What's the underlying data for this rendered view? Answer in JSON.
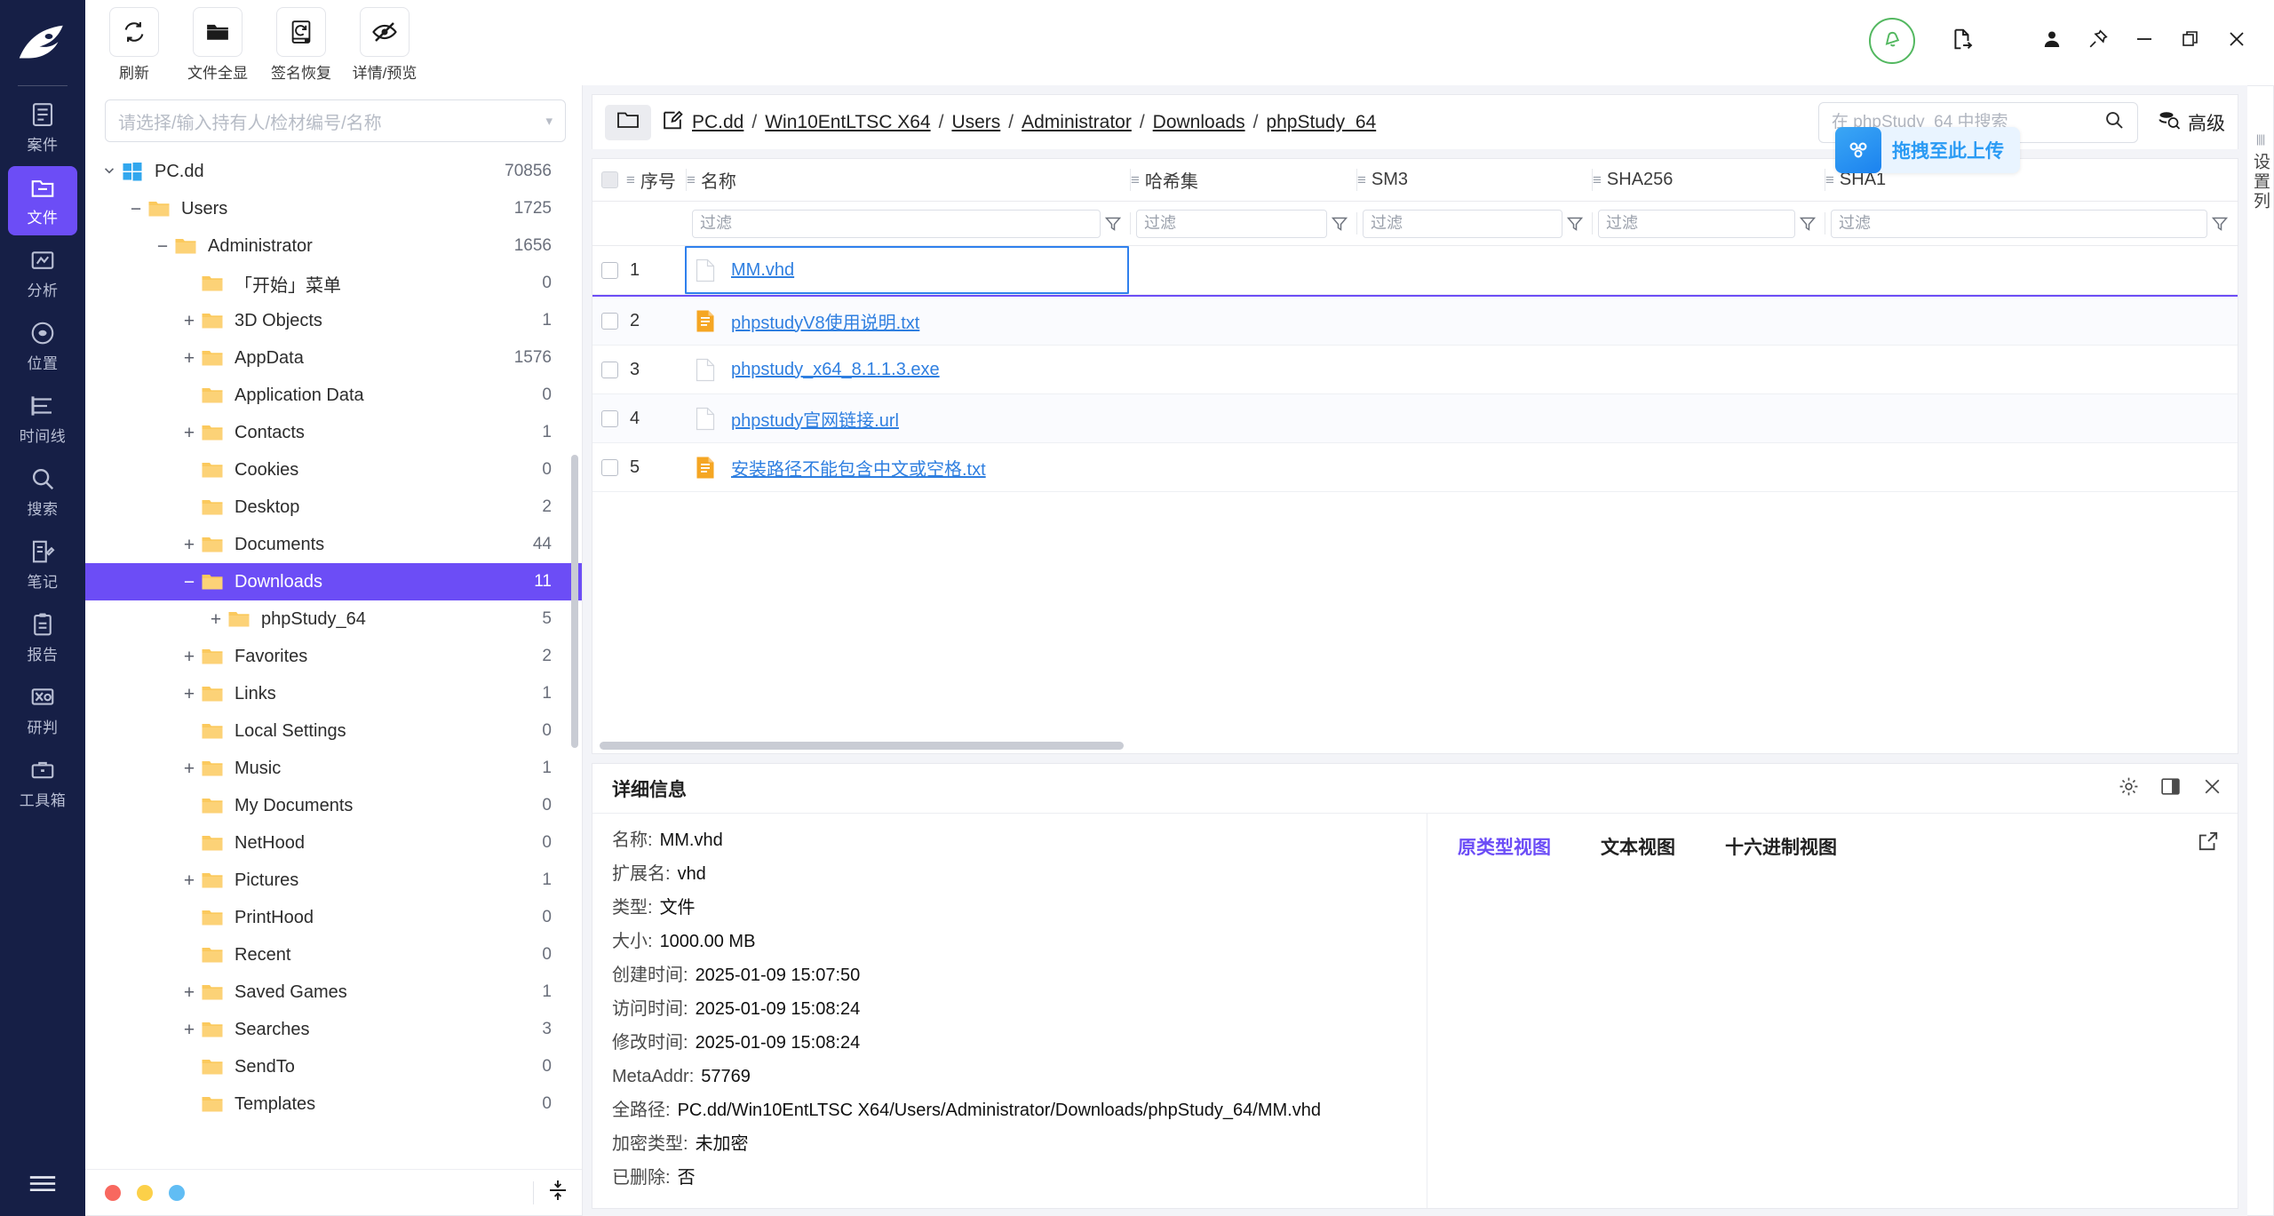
{
  "rail": {
    "items": [
      {
        "label": "案件",
        "icon": "case-icon",
        "active": false
      },
      {
        "label": "文件",
        "icon": "folder-icon",
        "active": true
      },
      {
        "label": "分析",
        "icon": "analysis-icon",
        "active": false
      },
      {
        "label": "位置",
        "icon": "location-icon",
        "active": false
      },
      {
        "label": "时间线",
        "icon": "timeline-icon",
        "active": false
      },
      {
        "label": "搜索",
        "icon": "search-icon",
        "active": false
      },
      {
        "label": "笔记",
        "icon": "note-icon",
        "active": false
      },
      {
        "label": "报告",
        "icon": "report-icon",
        "active": false
      },
      {
        "label": "研判",
        "icon": "judgement-icon",
        "active": false
      },
      {
        "label": "工具箱",
        "icon": "toolbox-icon",
        "active": false
      }
    ]
  },
  "toolbar": {
    "buttons": [
      {
        "label": "刷新",
        "icon": "refresh-icon"
      },
      {
        "label": "文件全显",
        "icon": "folder-all-icon"
      },
      {
        "label": "签名恢复",
        "icon": "signature-recover-icon"
      },
      {
        "label": "详情/预览",
        "icon": "eye-off-icon"
      }
    ]
  },
  "tree": {
    "search_placeholder": "请选择/输入持有人/检材编号/名称",
    "nodes": [
      {
        "label": "PC.dd",
        "count": "70856",
        "depth": 0,
        "expander": "collapse-caret",
        "icon": "windows-icon",
        "selected": false
      },
      {
        "label": "Users",
        "count": "1725",
        "depth": 1,
        "expander": "minus",
        "icon": "folder-icon",
        "selected": false
      },
      {
        "label": "Administrator",
        "count": "1656",
        "depth": 2,
        "expander": "minus",
        "icon": "folder-icon",
        "selected": false
      },
      {
        "label": "「开始」菜单",
        "count": "0",
        "depth": 3,
        "expander": "none",
        "icon": "folder-icon",
        "selected": false
      },
      {
        "label": "3D Objects",
        "count": "1",
        "depth": 3,
        "expander": "plus",
        "icon": "folder-icon",
        "selected": false
      },
      {
        "label": "AppData",
        "count": "1576",
        "depth": 3,
        "expander": "plus",
        "icon": "folder-icon",
        "selected": false
      },
      {
        "label": "Application Data",
        "count": "0",
        "depth": 3,
        "expander": "none",
        "icon": "folder-icon",
        "selected": false
      },
      {
        "label": "Contacts",
        "count": "1",
        "depth": 3,
        "expander": "plus",
        "icon": "folder-icon",
        "selected": false
      },
      {
        "label": "Cookies",
        "count": "0",
        "depth": 3,
        "expander": "none",
        "icon": "folder-icon",
        "selected": false
      },
      {
        "label": "Desktop",
        "count": "2",
        "depth": 3,
        "expander": "none",
        "icon": "folder-icon",
        "selected": false
      },
      {
        "label": "Documents",
        "count": "44",
        "depth": 3,
        "expander": "plus",
        "icon": "folder-icon",
        "selected": false
      },
      {
        "label": "Downloads",
        "count": "11",
        "depth": 3,
        "expander": "minus",
        "icon": "folder-icon",
        "selected": true
      },
      {
        "label": "phpStudy_64",
        "count": "5",
        "depth": 4,
        "expander": "plus",
        "icon": "folder-icon",
        "selected": false
      },
      {
        "label": "Favorites",
        "count": "2",
        "depth": 3,
        "expander": "plus",
        "icon": "folder-icon",
        "selected": false
      },
      {
        "label": "Links",
        "count": "1",
        "depth": 3,
        "expander": "plus",
        "icon": "folder-icon",
        "selected": false
      },
      {
        "label": "Local Settings",
        "count": "0",
        "depth": 3,
        "expander": "none",
        "icon": "folder-icon",
        "selected": false
      },
      {
        "label": "Music",
        "count": "1",
        "depth": 3,
        "expander": "plus",
        "icon": "folder-icon",
        "selected": false
      },
      {
        "label": "My Documents",
        "count": "0",
        "depth": 3,
        "expander": "none",
        "icon": "folder-icon",
        "selected": false
      },
      {
        "label": "NetHood",
        "count": "0",
        "depth": 3,
        "expander": "none",
        "icon": "folder-icon",
        "selected": false
      },
      {
        "label": "Pictures",
        "count": "1",
        "depth": 3,
        "expander": "plus",
        "icon": "folder-icon",
        "selected": false
      },
      {
        "label": "PrintHood",
        "count": "0",
        "depth": 3,
        "expander": "none",
        "icon": "folder-icon",
        "selected": false
      },
      {
        "label": "Recent",
        "count": "0",
        "depth": 3,
        "expander": "none",
        "icon": "folder-icon",
        "selected": false
      },
      {
        "label": "Saved Games",
        "count": "1",
        "depth": 3,
        "expander": "plus",
        "icon": "folder-icon",
        "selected": false
      },
      {
        "label": "Searches",
        "count": "3",
        "depth": 3,
        "expander": "plus",
        "icon": "folder-icon",
        "selected": false
      },
      {
        "label": "SendTo",
        "count": "0",
        "depth": 3,
        "expander": "none",
        "icon": "folder-icon",
        "selected": false
      },
      {
        "label": "Templates",
        "count": "0",
        "depth": 3,
        "expander": "none",
        "icon": "folder-icon",
        "selected": false
      }
    ],
    "footer_dots": [
      "#f8685f",
      "#fcd049",
      "#61bdf4"
    ]
  },
  "breadcrumb": {
    "segments": [
      "PC.dd",
      "Win10EntLTSC X64",
      "Users",
      "Administrator",
      "Downloads",
      "phpStudy_64"
    ],
    "separator": "/"
  },
  "search": {
    "placeholder": "在 phpStudy_64 中搜索",
    "value": "",
    "advanced_label": "高级"
  },
  "upload_badge": {
    "label": "拖拽至此上传"
  },
  "column_setting": {
    "label": "设置列"
  },
  "table": {
    "columns": [
      "序号",
      "名称",
      "哈希集",
      "SM3",
      "SHA256",
      "SHA1"
    ],
    "filter_placeholder": "过滤",
    "rows": [
      {
        "index": "1",
        "name": "MM.vhd",
        "icon": "file-blank-icon",
        "hash": "",
        "sm3": "",
        "sha256": "",
        "sha1": "",
        "selected": true
      },
      {
        "index": "2",
        "name": "phpstudyV8使用说明.txt",
        "icon": "file-text-icon",
        "hash": "",
        "sm3": "",
        "sha256": "",
        "sha1": "",
        "selected": false
      },
      {
        "index": "3",
        "name": "phpstudy_x64_8.1.1.3.exe",
        "icon": "file-blank-icon",
        "hash": "",
        "sm3": "",
        "sha256": "",
        "sha1": "",
        "selected": false
      },
      {
        "index": "4",
        "name": "phpstudy官网链接.url",
        "icon": "file-blank-icon",
        "hash": "",
        "sm3": "",
        "sha256": "",
        "sha1": "",
        "selected": false
      },
      {
        "index": "5",
        "name": "安装路径不能包含中文或空格.txt",
        "icon": "file-text-icon",
        "hash": "",
        "sm3": "",
        "sha256": "",
        "sha1": "",
        "selected": false
      }
    ]
  },
  "detail": {
    "title": "详细信息",
    "fields": [
      {
        "key": "名称:",
        "value": "MM.vhd"
      },
      {
        "key": "扩展名:",
        "value": "vhd"
      },
      {
        "key": "类型:",
        "value": "文件"
      },
      {
        "key": "大小:",
        "value": "1000.00 MB"
      },
      {
        "key": "创建时间:",
        "value": "2025-01-09 15:07:50"
      },
      {
        "key": "访问时间:",
        "value": "2025-01-09 15:08:24"
      },
      {
        "key": "修改时间:",
        "value": "2025-01-09 15:08:24"
      },
      {
        "key": "MetaAddr:",
        "value": "57769"
      },
      {
        "key": "全路径:",
        "value": "PC.dd/Win10EntLTSC X64/Users/Administrator/Downloads/phpStudy_64/MM.vhd"
      },
      {
        "key": "加密类型:",
        "value": "未加密"
      },
      {
        "key": "已删除:",
        "value": "否"
      }
    ],
    "view_tabs": [
      {
        "label": "原类型视图",
        "active": true
      },
      {
        "label": "文本视图",
        "active": false
      },
      {
        "label": "十六进制视图",
        "active": false
      }
    ]
  },
  "colors": {
    "rail_bg": "#161f46",
    "accent": "#6c4df6",
    "link": "#2f7fe0",
    "folder": "#fcd277",
    "bell_green": "#53b860",
    "upload_blue": "#2b9bf4"
  }
}
